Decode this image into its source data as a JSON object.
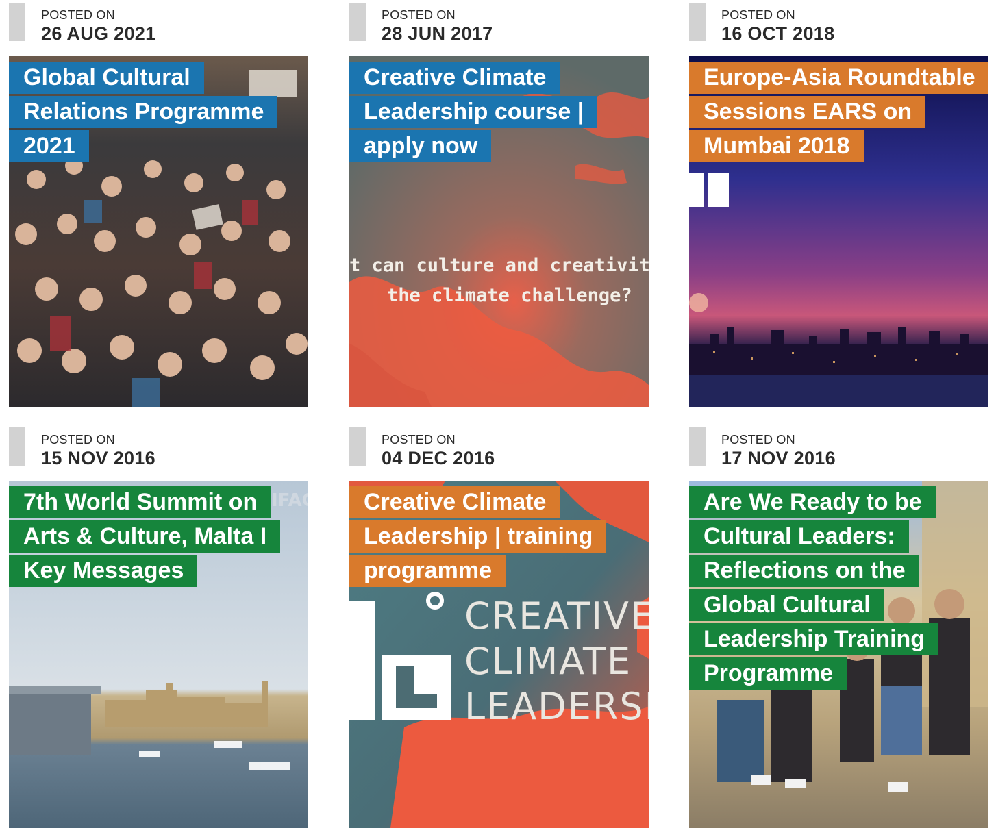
{
  "posts": [
    {
      "posted_label": "POSTED ON",
      "date": "26 AUG 2021",
      "title": "Global Cultural Relations Programme 2021",
      "title_color": "#1b75b0",
      "image": "crowd-photo"
    },
    {
      "posted_label": "POSTED ON",
      "date": "28 JUN 2017",
      "title": "Creative Climate Leadership course | apply now",
      "title_color": "#1b75b0",
      "image": "climate-banner",
      "image_text": [
        "t can culture and creativity",
        "the climate challenge?"
      ]
    },
    {
      "posted_label": "POSTED ON",
      "date": "16 OCT 2018",
      "title": "Europe-Asia Roundtable Sessions EARS on Mumbai 2018",
      "title_color": "#d97a2c",
      "image": "mumbai-skyline"
    },
    {
      "posted_label": "POSTED ON",
      "date": "15 NOV 2016",
      "title": "7th World Summit on Arts & Culture, Malta I Key Messages",
      "title_color": "#16853c",
      "image": "malta-harbour",
      "image_text": [
        "IFAC"
      ]
    },
    {
      "posted_label": "POSTED ON",
      "date": "04 DEC 2016",
      "title": "Creative Climate Leadership | training programme",
      "title_color": "#d97a2c",
      "image": "ccl-logo",
      "image_text": [
        "CREATIVE",
        "CLIMATE",
        "LEADERSHI"
      ]
    },
    {
      "posted_label": "POSTED ON",
      "date": "17 NOV 2016",
      "title": "Are We Ready to be Cultural Leaders: Reflections on the Global Cultural Leadership Training Programme",
      "title_color": "#16853c",
      "image": "group-photo"
    }
  ]
}
